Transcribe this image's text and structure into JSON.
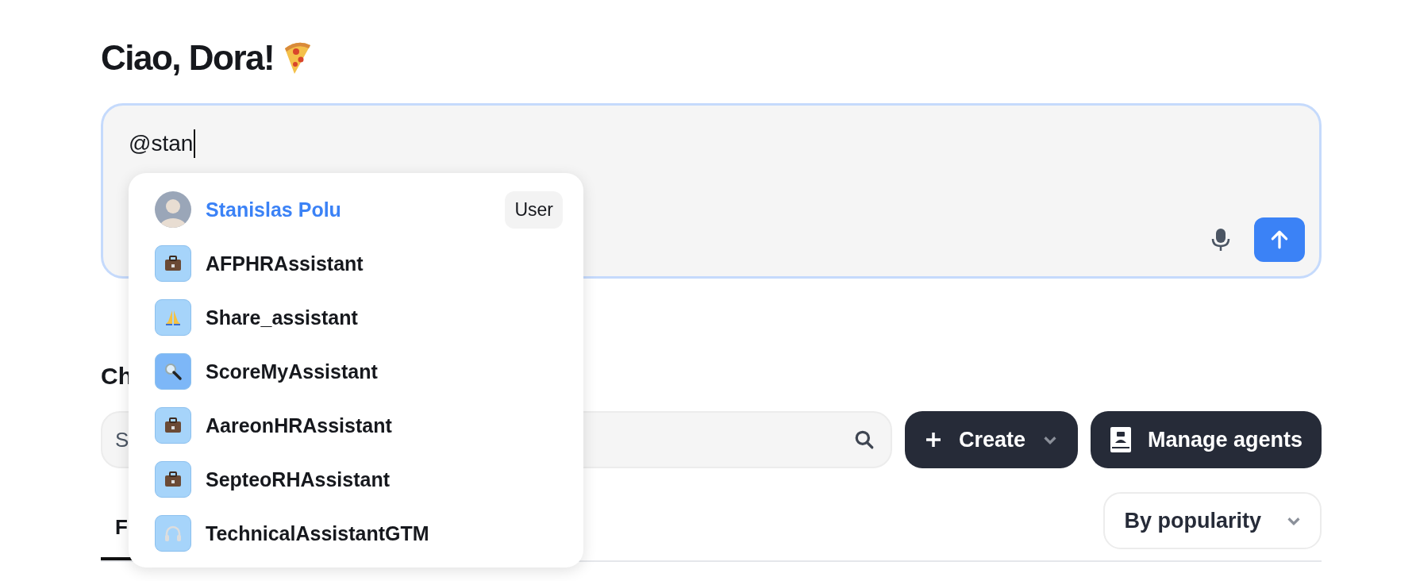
{
  "greeting": "Ciao, Dora!",
  "composer": {
    "value": "@stan"
  },
  "mentions": [
    {
      "kind": "user",
      "name": "Stanislas Polu",
      "badge": "User",
      "selected": true
    },
    {
      "kind": "briefcase",
      "name": "AFPHRAssistant",
      "color": "#a6d4fa",
      "selected": false
    },
    {
      "kind": "hands",
      "name": "Share_assistant",
      "color": "#a6d4fa",
      "selected": false
    },
    {
      "kind": "magnifier",
      "name": "ScoreMyAssistant",
      "color": "#7db7f7",
      "selected": false
    },
    {
      "kind": "briefcase",
      "name": "AareonHRAssistant",
      "color": "#a6d4fa",
      "selected": false
    },
    {
      "kind": "briefcase",
      "name": "SepteoRHAssistant",
      "color": "#a6d4fa",
      "selected": false
    },
    {
      "kind": "headphones",
      "name": "TechnicalAssistantGTM",
      "color": "#a6d4fa",
      "selected": false
    }
  ],
  "section_title": "Ch",
  "search": {
    "placeholder": "S"
  },
  "buttons": [
    {
      "kind": "create",
      "label": "Create"
    },
    {
      "kind": "manage",
      "label": "Manage agents"
    }
  ],
  "tabs": [
    {
      "label": "F",
      "selected": true
    }
  ],
  "sort": {
    "label": "By popularity"
  }
}
